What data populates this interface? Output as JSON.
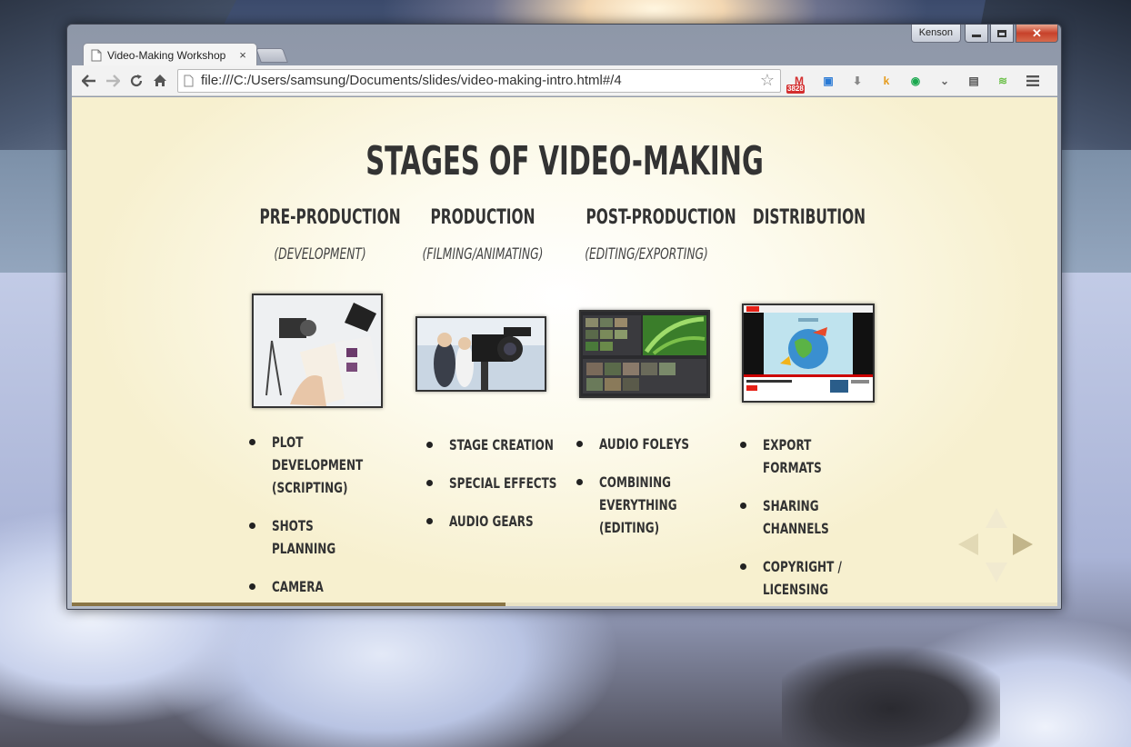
{
  "window": {
    "profile_name": "Kenson",
    "close_glyph": "✕"
  },
  "tab": {
    "title": "Video-Making Workshop",
    "close": "×"
  },
  "toolbar": {
    "url": "file:///C:/Users/samsung/Documents/slides/video-making-intro.html#/4",
    "star": "☆",
    "extensions": [
      {
        "name": "gmail-icon",
        "label": "M",
        "badge": "3828",
        "color": "#d32f2f"
      },
      {
        "name": "calendar-icon",
        "label": "▣",
        "color": "#2a7ad5"
      },
      {
        "name": "download-icon",
        "label": "⬇",
        "color": "#888888"
      },
      {
        "name": "kindle-icon",
        "label": "k",
        "color": "#e59a1a"
      },
      {
        "name": "pushbullet-icon",
        "label": "◉",
        "color": "#1aa84e"
      },
      {
        "name": "pocket-icon",
        "label": "⌄",
        "color": "#666666"
      },
      {
        "name": "evernote-icon",
        "label": "▤",
        "color": "#555555"
      },
      {
        "name": "audio-icon",
        "label": "≋",
        "color": "#6cc04a"
      }
    ]
  },
  "slide": {
    "title": "STAGES OF VIDEO-MAKING",
    "columns": [
      {
        "heading": "PRE-PRODUCTION",
        "sub": "(DEVELOPMENT)",
        "bullets": [
          "PLOT DEVELOPMENT (SCRIPTING)",
          "SHOTS PLANNING",
          "CAMERA FRAMING (STORYBOARDING)"
        ]
      },
      {
        "heading": "PRODUCTION",
        "sub": "(FILMING/ANIMATING)",
        "bullets": [
          "STAGE CREATION",
          "SPECIAL EFFECTS",
          "AUDIO GEARS"
        ]
      },
      {
        "heading": "POST-PRODUCTION",
        "sub": "(EDITING/EXPORTING)",
        "bullets": [
          "AUDIO FOLEYS",
          "COMBINING EVERYTHING (EDITING)"
        ]
      },
      {
        "heading": "DISTRIBUTION",
        "sub": "",
        "bullets": [
          "EXPORT FORMATS",
          "SHARING CHANNELS",
          "COPYRIGHT / LICENSING"
        ]
      }
    ],
    "progress_fraction": 0.44
  }
}
